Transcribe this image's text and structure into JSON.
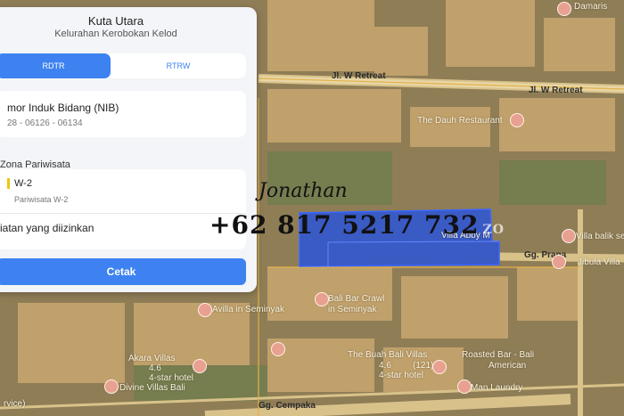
{
  "panel": {
    "title": "Kuta Utara",
    "subtitle": "Kelurahan Kerobokan Kelod",
    "tabs": [
      {
        "label": "RDTR"
      },
      {
        "label": "RTRW"
      }
    ],
    "nib_label": "mor Induk Bidang (NIB)",
    "nib_value": "28 - 06126 - 06134",
    "zone_section": "Zona Pariwisata",
    "zone_code": "W-2",
    "zone_desc": "Pariwisata W-2",
    "activity_label": "iatan yang diizinkan",
    "print_label": "Cetak",
    "accent_color": "#3d82f0"
  },
  "map": {
    "roads": [
      "Jl. W Retreat",
      "Jl. W Retreat",
      "Gg. Prana",
      "Gg. Cempaka"
    ],
    "places": [
      "Damaris",
      "The Dauh Restaurant",
      "Villa Abby M",
      "Villa balik se",
      "Jibula Villa",
      "Bali Bar Crawl",
      "in Seminyak",
      "Avilla in Seminyak",
      "Akara Villas",
      "4.6",
      "4-star hotel",
      "The Buah Bali Villas",
      "4.6",
      "(121)",
      "4-star hotel",
      "Roasted Bar - Bali",
      "American",
      "Divine Villas Bali",
      "rvice)",
      "Man Laundry"
    ],
    "selection_color": "#2f55d4"
  },
  "overlay": {
    "signature": "Jonathan",
    "phone": "+62 817 5217 732",
    "watermark_suffix": "ZO"
  }
}
